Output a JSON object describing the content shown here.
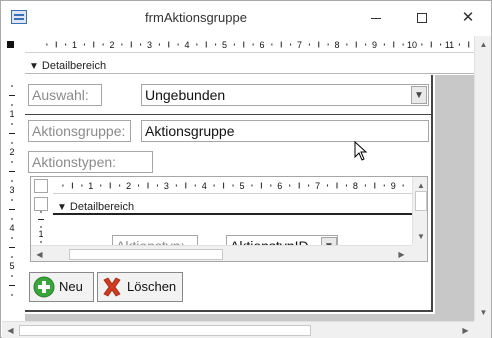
{
  "window": {
    "title": "frmAktionsgruppe"
  },
  "ruler": {
    "numbers": [
      "1",
      "2",
      "3",
      "4",
      "5",
      "6",
      "7",
      "8",
      "9",
      "10",
      "11"
    ],
    "vnumbers": [
      "1",
      "2",
      "3",
      "4",
      "5"
    ]
  },
  "detail_section": {
    "label": "Detailbereich"
  },
  "auswahl": {
    "label": "Auswahl:",
    "value": "Ungebunden"
  },
  "aktionsgruppe": {
    "label": "Aktionsgruppe:",
    "value": "Aktionsgruppe"
  },
  "aktionstypen": {
    "label": "Aktionstypen:",
    "subform": {
      "ruler_numbers": [
        "1",
        "2",
        "3",
        "4",
        "5",
        "6",
        "7",
        "8",
        "9",
        "10"
      ],
      "section_label": "Detailbereich",
      "field_label": "Aktionstyp:",
      "field_value": "AktionstypID"
    }
  },
  "buttons": {
    "new_label": "Neu",
    "delete_label": "Löschen"
  },
  "icons": {
    "new": "plus-circle-icon",
    "delete": "red-x-icon"
  },
  "colors": {
    "accent_green": "#3aa53a",
    "delete_red": "#d23a1f"
  }
}
